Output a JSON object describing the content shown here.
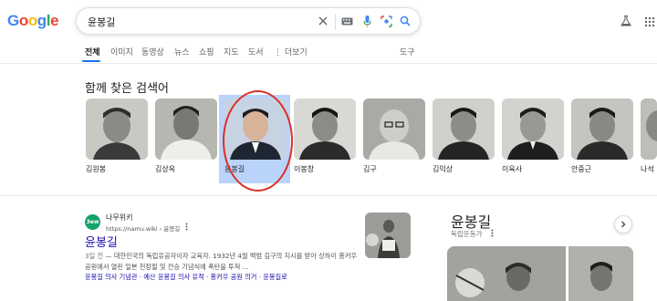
{
  "header": {
    "logo_letters": [
      "G",
      "o",
      "o",
      "g",
      "l",
      "e"
    ],
    "search": {
      "value": "윤봉길"
    }
  },
  "tabs": [
    {
      "label": "전체",
      "active": true
    },
    {
      "label": "이미지"
    },
    {
      "label": "동영상"
    },
    {
      "label": "뉴스"
    },
    {
      "label": "쇼핑"
    },
    {
      "label": "지도"
    },
    {
      "label": "도서"
    },
    {
      "label": "⋮ 더보기"
    },
    {
      "label": "도구"
    }
  ],
  "related": {
    "title": "함께 찾은 검색어",
    "items": [
      {
        "name": "김원봉"
      },
      {
        "name": "김상옥"
      },
      {
        "name": "윤봉길",
        "selected": true
      },
      {
        "name": "이봉창"
      },
      {
        "name": "김구"
      },
      {
        "name": "김익상"
      },
      {
        "name": "이육사"
      },
      {
        "name": "안중근"
      },
      {
        "name": "나석"
      }
    ]
  },
  "result": {
    "favicon_text": "3ew",
    "site_name": "나무위키",
    "site_url": "https://namu.wiki › 윤봉길",
    "title": "윤봉길",
    "snippet_date": "3일 전",
    "snippet": " — 대한민국의 독립유공자이자 교육자. 1932년 4월 백범 김구의 지시를 받아 상하이 홍커우 공원에서 열린 일본 천장절 및 전승 기념식에 폭탄을 투척 ...",
    "sublinks": "윤봉길 의사 기념관 · 예산 윤봉길 의사 유적 · 홍커우 공원 의거 · 윤봉길로"
  },
  "knowledge_panel": {
    "title": "윤봉길",
    "subtitle": "독립운동가"
  },
  "colors": {
    "link": "#1a0dab",
    "accent": "#1a73e8",
    "highlight": "#aecbfa",
    "annotation_circle": "#d93025"
  }
}
